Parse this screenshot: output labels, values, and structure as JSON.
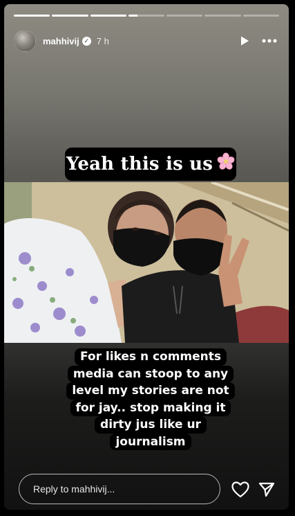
{
  "header": {
    "username": "mahhivij",
    "time": "7 h",
    "verified_mark": "✓"
  },
  "progress": {
    "segments": [
      1,
      1,
      1,
      0.25,
      0,
      0,
      0
    ]
  },
  "captions": {
    "top": "Yeah this is us",
    "top_emoji": "cherry-blossom-icon",
    "bottom_lines": [
      "For likes n comments",
      "media can stoop to any",
      "level my stories are not",
      "for jay.. stop making it",
      "dirty jus like ur",
      "journalism"
    ]
  },
  "reply": {
    "placeholder": "Reply to mahhivij..."
  },
  "icons": {
    "play": "play-icon",
    "more": "more-icon",
    "heart": "heart-icon",
    "share": "send-icon"
  },
  "colors": {
    "pill_bg": "#000000",
    "text": "#ffffff"
  }
}
